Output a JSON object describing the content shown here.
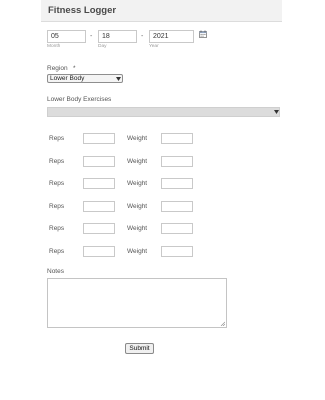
{
  "header": {
    "title": "Fitness Logger"
  },
  "date": {
    "month": {
      "value": "05",
      "sublabel": "Month"
    },
    "day": {
      "value": "18",
      "sublabel": "Day"
    },
    "year": {
      "value": "2021",
      "sublabel": "Year"
    },
    "separator": "-",
    "calendar_icon": "calendar-icon"
  },
  "region": {
    "label": "Region",
    "required_mark": "*",
    "selected": "Lower Body",
    "dropdown_icon": "triangle-down"
  },
  "exercises": {
    "label": "Lower Body Exercises",
    "selected": "",
    "dropdown_icon": "triangle-down"
  },
  "sets": [
    {
      "reps_label": "Reps",
      "reps_value": "",
      "weight_label": "Weight",
      "weight_value": ""
    },
    {
      "reps_label": "Reps",
      "reps_value": "",
      "weight_label": "Weight",
      "weight_value": ""
    },
    {
      "reps_label": "Reps",
      "reps_value": "",
      "weight_label": "Weight",
      "weight_value": ""
    },
    {
      "reps_label": "Reps",
      "reps_value": "",
      "weight_label": "Weight",
      "weight_value": ""
    },
    {
      "reps_label": "Reps",
      "reps_value": "",
      "weight_label": "Weight",
      "weight_value": ""
    },
    {
      "reps_label": "Reps",
      "reps_value": "",
      "weight_label": "Weight",
      "weight_value": ""
    }
  ],
  "notes": {
    "label": "Notes",
    "value": ""
  },
  "submit": {
    "label": "Submit"
  },
  "colors": {
    "header_bg": "#f2f2f2",
    "page_bg": "#ffffff",
    "field_border": "#c9c9c9"
  }
}
